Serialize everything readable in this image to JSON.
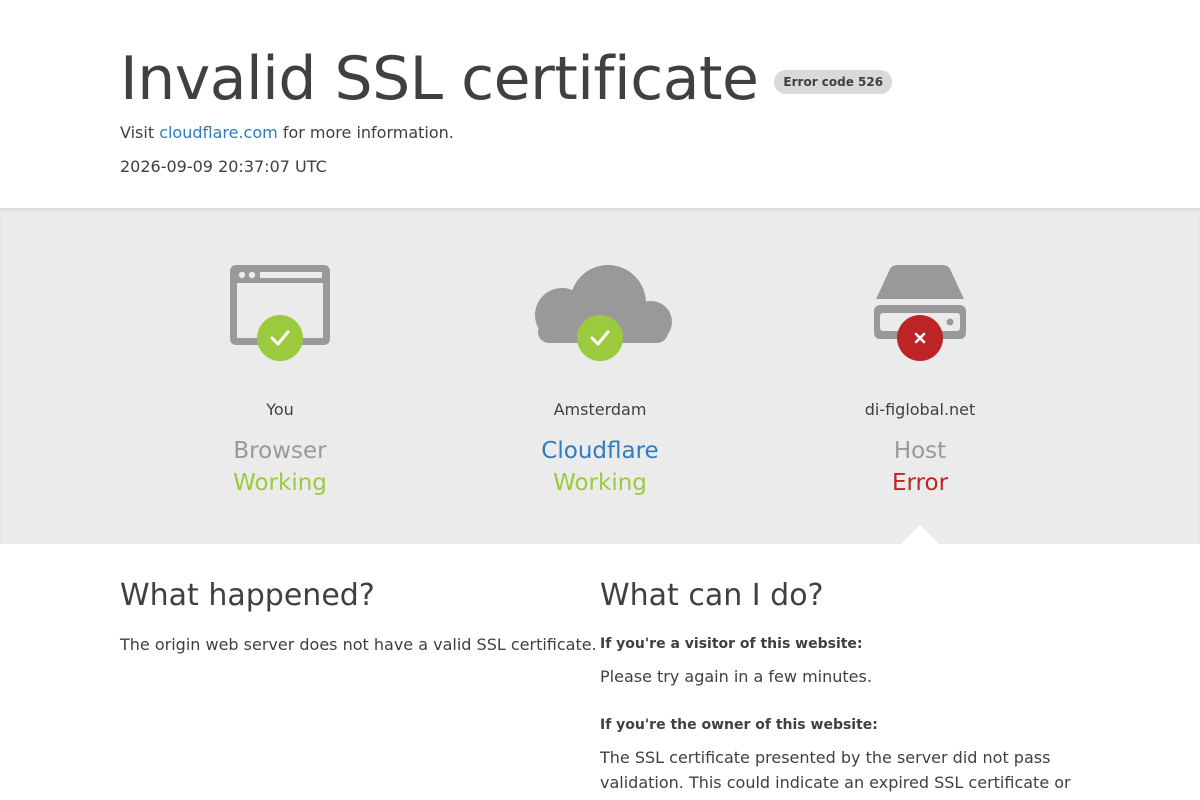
{
  "header": {
    "title": "Invalid SSL certificate",
    "error_code": "Error code 526",
    "visit_prefix": "Visit",
    "visit_link": "cloudflare.com",
    "visit_suffix": " for more information.",
    "timestamp": "2026-09-09 20:37:07 UTC"
  },
  "status": [
    {
      "icon": "browser-icon",
      "location": "You",
      "role": "Browser",
      "state": "Working",
      "state_kind": "ok"
    },
    {
      "icon": "cloud-icon",
      "location": "Amsterdam",
      "role": "Cloudflare",
      "state": "Working",
      "state_kind": "ok"
    },
    {
      "icon": "server-icon",
      "location": "di-figlobal.net",
      "role": "Host",
      "state": "Error",
      "state_kind": "error"
    }
  ],
  "colors": {
    "ok": "#9bca3e",
    "error": "#bd2426",
    "link": "#2f7bbf",
    "icon_gray": "#999999"
  },
  "what_happened": {
    "heading": "What happened?",
    "text": "The origin web server does not have a valid SSL certificate."
  },
  "what_can_i_do": {
    "heading": "What can I do?",
    "visitor_heading": "If you're a visitor of this website:",
    "visitor_text": "Please try again in a few minutes.",
    "owner_heading": "If you're the owner of this website:",
    "owner_text": "The SSL certificate presented by the server did not pass validation. This could indicate an expired SSL certificate or a"
  }
}
